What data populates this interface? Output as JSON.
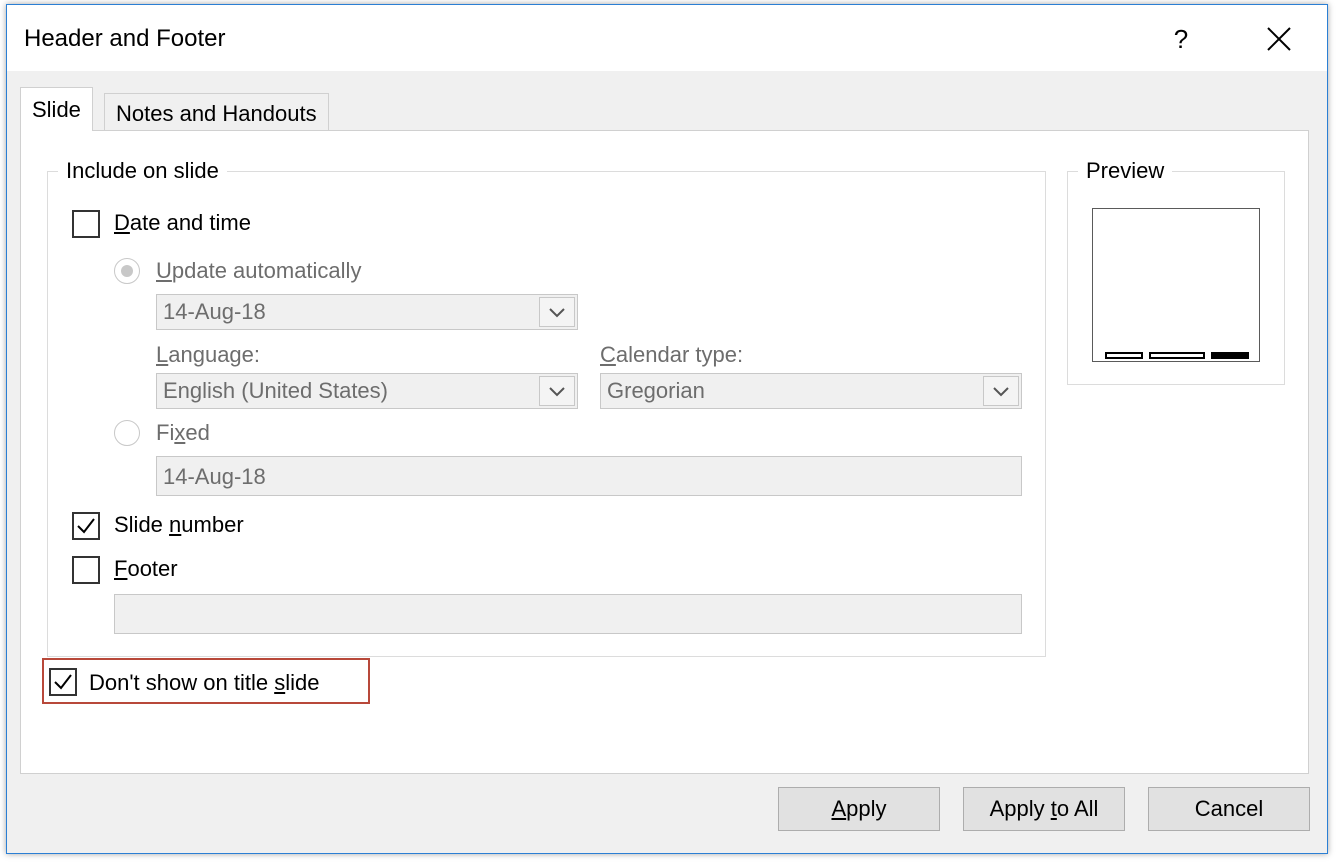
{
  "window": {
    "title": "Header and Footer",
    "help_label": "?"
  },
  "tabs": [
    {
      "label": "Slide",
      "active": true
    },
    {
      "label": "Notes and Handouts",
      "active": false
    }
  ],
  "include_group": {
    "legend": "Include on slide",
    "date_time": {
      "label_ul": "D",
      "label_rest": "ate and time",
      "checked": false
    },
    "update_auto": {
      "label_ul": "U",
      "label_rest": "pdate automatically",
      "selected": true
    },
    "date_select": {
      "value": "14-Aug-18"
    },
    "language": {
      "label_ul": "L",
      "label_rest": "anguage:",
      "value": "English (United States)"
    },
    "calendar": {
      "label_ul": "C",
      "label_rest": "alendar type:",
      "value": "Gregorian"
    },
    "fixed": {
      "label_pre": "Fi",
      "label_ul": "x",
      "label_rest": "ed",
      "value": "14-Aug-18",
      "selected": false
    },
    "slide_number": {
      "label_pre": "Slide ",
      "label_ul": "n",
      "label_rest": "umber",
      "checked": true
    },
    "footer": {
      "label_ul": "F",
      "label_rest": "ooter",
      "checked": false,
      "value": ""
    }
  },
  "dont_show": {
    "label_pre": "Don't show on title ",
    "label_ul": "s",
    "label_rest": "lide",
    "checked": true
  },
  "preview": {
    "legend": "Preview"
  },
  "buttons": {
    "apply": {
      "label_ul": "A",
      "label_rest": "pply"
    },
    "apply_all": {
      "label_pre": "Apply ",
      "label_ul": "t",
      "label_rest": "o All"
    },
    "cancel": {
      "label": "Cancel"
    }
  },
  "colors": {
    "window_border": "#2b7fd4",
    "highlight_border": "#b8483a",
    "disabled_text": "#6d6d6d"
  }
}
